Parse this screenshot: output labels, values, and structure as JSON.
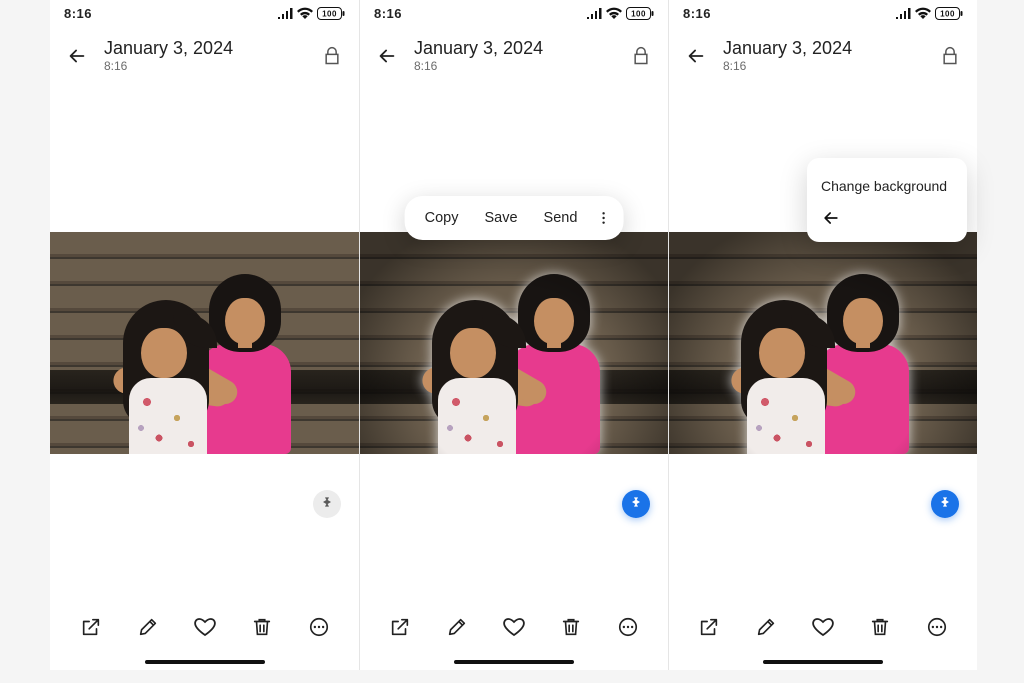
{
  "status": {
    "time": "8:16",
    "battery": "100"
  },
  "header": {
    "date": "January 3, 2024",
    "time": "8:16"
  },
  "popup": {
    "copy": "Copy",
    "save": "Save",
    "send": "Send"
  },
  "sheet": {
    "change_bg": "Change background"
  },
  "accent_color": "#1a73e8"
}
